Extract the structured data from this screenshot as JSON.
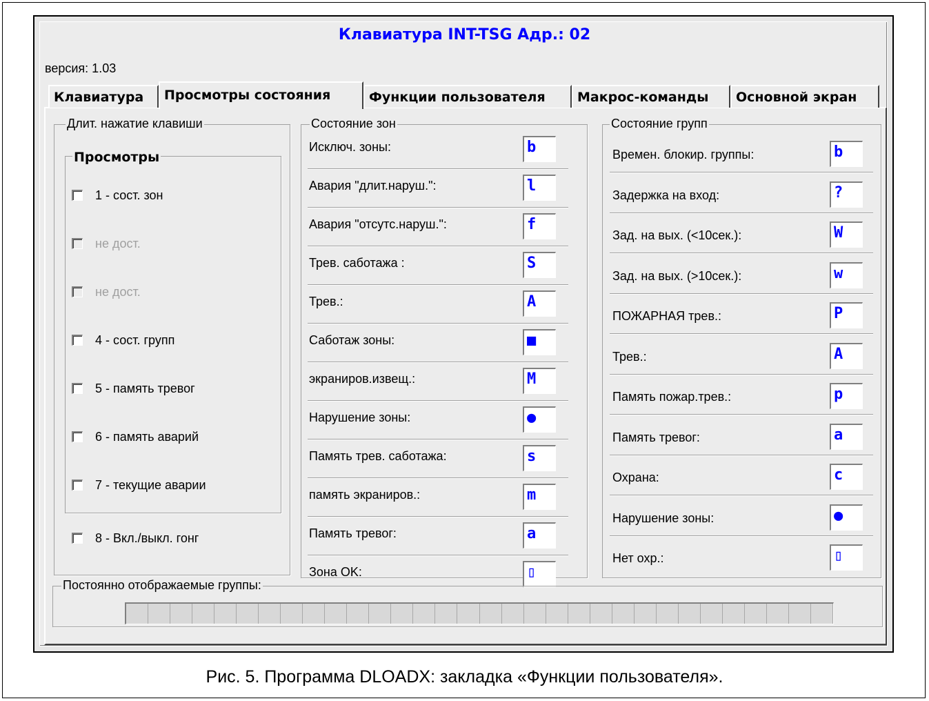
{
  "window": {
    "title": "Клавиатура INT-TSG Адр.: 02",
    "version": "версия: 1.03"
  },
  "tabs": [
    {
      "label": "Клавиатура",
      "active": false
    },
    {
      "label": "Просмотры состояния",
      "active": true
    },
    {
      "label": "Функции пользователя",
      "active": false
    },
    {
      "label": "Макрос-команды",
      "active": false
    },
    {
      "label": "Основной экран",
      "active": false
    }
  ],
  "long_press": {
    "legend": "Длит. нажатие клавиши",
    "views_legend": "Просмотры",
    "items": [
      {
        "label": "1 - сост. зон",
        "enabled": true,
        "checked": false
      },
      {
        "label": "не дост.",
        "enabled": false,
        "checked": false
      },
      {
        "label": "не дост.",
        "enabled": false,
        "checked": false
      },
      {
        "label": "4 - сост. групп",
        "enabled": true,
        "checked": false
      },
      {
        "label": "5 - память тревог",
        "enabled": true,
        "checked": false
      },
      {
        "label": "6 - память аварий",
        "enabled": true,
        "checked": false
      },
      {
        "label": "7 - текущие аварии",
        "enabled": true,
        "checked": false
      }
    ],
    "chime": {
      "label": "8 - Вкл./выкл. гонг",
      "checked": false
    }
  },
  "zones": {
    "legend": "Состояние зон",
    "rows": [
      {
        "label": "Исключ. зоны:",
        "symbol": "b"
      },
      {
        "label": "Авария \"длит.наруш.\":",
        "symbol": "l"
      },
      {
        "label": "Авария \"отсутс.наруш.\":",
        "symbol": "f"
      },
      {
        "label": "Трев. саботажа :",
        "symbol": "S"
      },
      {
        "label": "Трев.:",
        "symbol": "A"
      },
      {
        "label": "Саботаж зоны:",
        "symbol": "■"
      },
      {
        "label": "экраниров.извещ.:",
        "symbol": "M"
      },
      {
        "label": "Нарушение зоны:",
        "symbol": "●"
      },
      {
        "label": "Память трев. саботажа:",
        "symbol": "s"
      },
      {
        "label": "память экраниров.:",
        "symbol": "m"
      },
      {
        "label": "Память тревог:",
        "symbol": "a"
      },
      {
        "label": "Зона OK:",
        "symbol": "▯"
      }
    ]
  },
  "groups": {
    "legend": "Состояние групп",
    "rows": [
      {
        "label": "Времен. блокир. группы:",
        "symbol": "b"
      },
      {
        "label": "Задержка на вход:",
        "symbol": "?"
      },
      {
        "label": "Зад. на вых. (<10сек.):",
        "symbol": "W"
      },
      {
        "label": "Зад. на вых. (>10сек.):",
        "symbol": "w"
      },
      {
        "label": "ПОЖАРНАЯ трев.:",
        "symbol": "P"
      },
      {
        "label": "Трев.:",
        "symbol": "A"
      },
      {
        "label": "Память пожар.трев.:",
        "symbol": "p"
      },
      {
        "label": "Память тревог:",
        "symbol": "a"
      },
      {
        "label": "Охрана:",
        "symbol": "c"
      },
      {
        "label": "Нарушение зоны:",
        "symbol": "●"
      },
      {
        "label": "Нет охр.:",
        "symbol": "▯"
      }
    ]
  },
  "permanent_groups": {
    "legend": "Постоянно отображаемые группы:"
  },
  "caption": "Рис. 5. Программа DLOADX: закладка «Функции пользователя».",
  "colors": {
    "title": "#0000ff",
    "symbol": "#0000ff",
    "window_bg": "#ececec"
  }
}
